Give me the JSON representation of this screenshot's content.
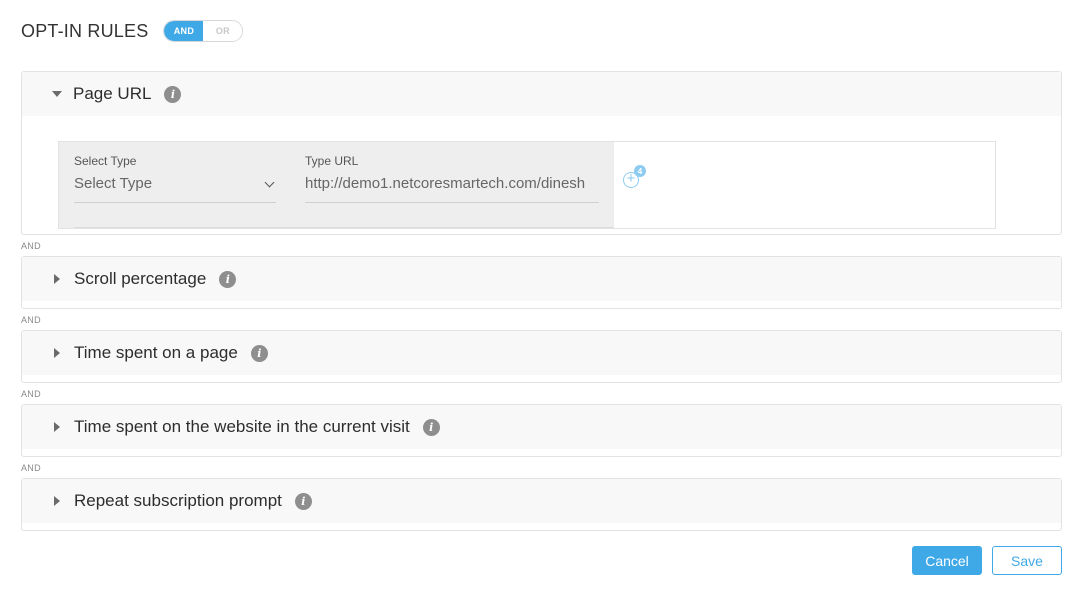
{
  "header": {
    "title": "OPT-IN RULES",
    "toggle": {
      "and_label": "AND",
      "or_label": "OR",
      "selected": "AND"
    }
  },
  "colors": {
    "accent": "#3fa9e8",
    "section_bg": "#f8f8f8",
    "info_icon": "#8e8e8e"
  },
  "sections": [
    {
      "title": "Page URL",
      "expanded": true,
      "icon": "info-icon"
    },
    {
      "title": "Scroll percentage",
      "expanded": false,
      "icon": "info-icon"
    },
    {
      "title": "Time spent on a page",
      "expanded": false,
      "icon": "info-icon"
    },
    {
      "title": "Time spent on the website in the current visit",
      "expanded": false,
      "icon": "info-icon"
    },
    {
      "title": "Repeat subscription prompt",
      "expanded": false,
      "icon": "info-icon"
    }
  ],
  "page_url": {
    "select_type": {
      "label": "Select Type",
      "value": "Select Type"
    },
    "type_url": {
      "label": "Type URL",
      "value": "http://demo1.netcoresmartech.com/dinesh"
    },
    "add_badge": "4"
  },
  "connector": "AND",
  "footer": {
    "cancel_label": "Cancel",
    "save_label": "Save"
  }
}
